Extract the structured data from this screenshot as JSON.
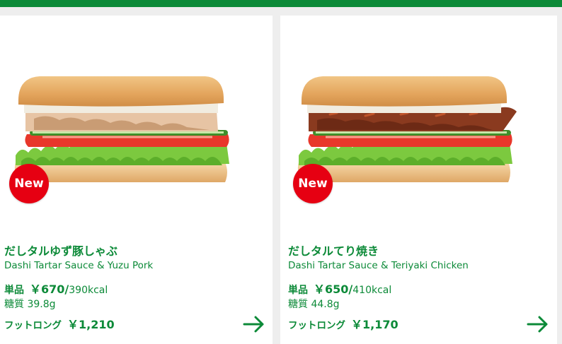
{
  "colors": {
    "brand_green": "#0c8a38",
    "badge_red": "#e60012",
    "background": "#eeeeee"
  },
  "products": [
    {
      "badge": "New",
      "name_jp": "だしタルゆず豚しゃぶ",
      "name_en": "Dashi Tartar Sauce & Yuzu Pork",
      "price_label": "単品",
      "price": "￥670/",
      "kcal": "390kcal",
      "carbs": "糖質 39.8g",
      "footlong_label": "フットロング",
      "footlong_price": "￥1,210",
      "filling": "yuzu-pork",
      "icon": "arrow-right-icon"
    },
    {
      "badge": "New",
      "name_jp": "だしタルてり焼き",
      "name_en": "Dashi Tartar Sauce & Teriyaki Chicken",
      "price_label": "単品",
      "price": "￥650/",
      "kcal": "410kcal",
      "carbs": "糖質 44.8g",
      "footlong_label": "フットロング",
      "footlong_price": "￥1,170",
      "filling": "teriyaki-chicken",
      "icon": "arrow-right-icon"
    }
  ]
}
